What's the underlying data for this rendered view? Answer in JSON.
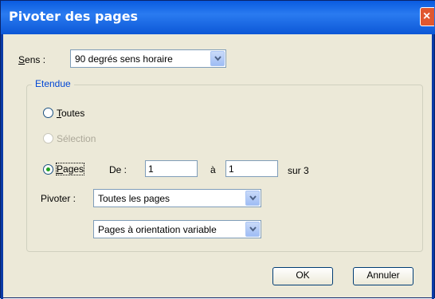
{
  "window": {
    "title": "Pivoter des pages",
    "close_glyph": "×"
  },
  "sens": {
    "label_prefix": "S",
    "label_rest": "ens :",
    "value": "90 degrés sens horaire"
  },
  "etendue": {
    "legend": "Etendue",
    "toutes": {
      "first": "T",
      "rest": "outes"
    },
    "selection": {
      "label": "Sélection"
    },
    "pages": {
      "first": "P",
      "rest": "ages",
      "selected": true
    },
    "de_label": "De :",
    "de_value": "1",
    "a_label": "à",
    "a_value": "1",
    "sur_label": "sur 3"
  },
  "pivoter": {
    "label": "Pivoter :",
    "scope_value": "Toutes les pages",
    "orientation_value": "Pages à orientation variable"
  },
  "buttons": {
    "ok": "OK",
    "cancel": "Annuler"
  }
}
